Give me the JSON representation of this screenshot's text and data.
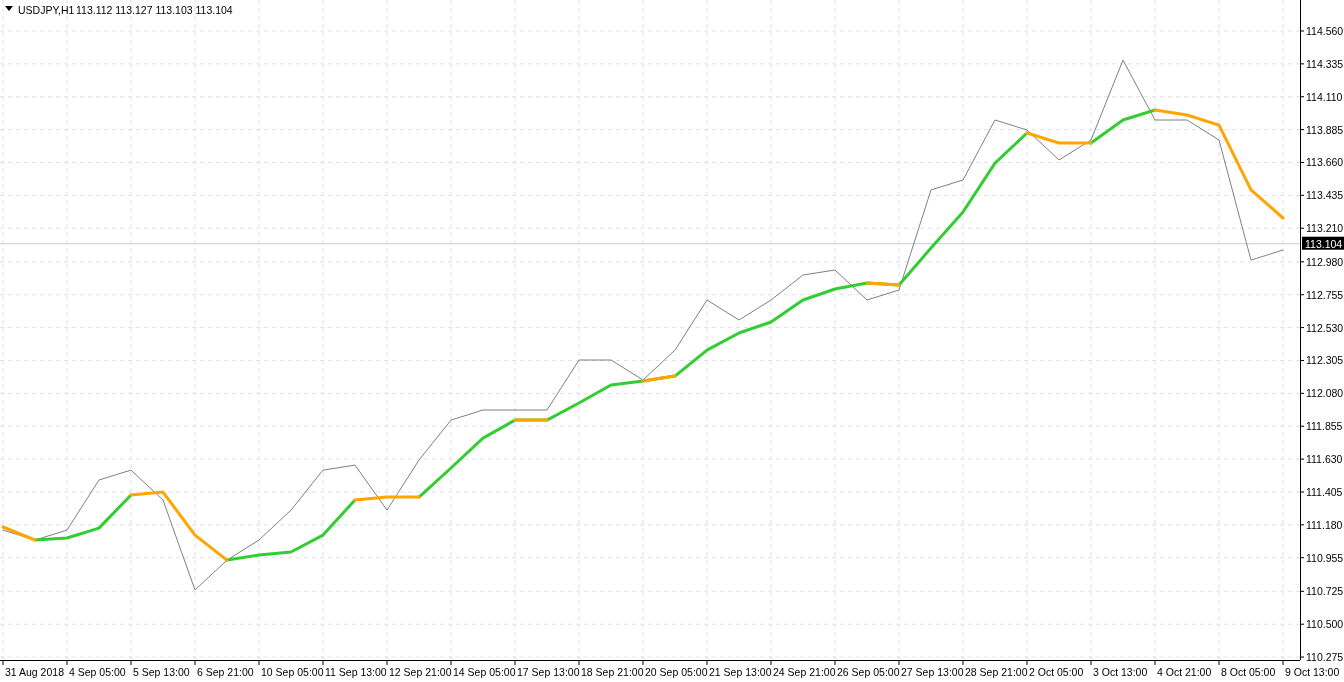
{
  "header": {
    "symbol": "USDJPY,H1",
    "quote": "113.112 113.127 113.103 113.104"
  },
  "chart_data": {
    "type": "line",
    "grid": true,
    "categories": [
      null,
      "31 Aug 2018",
      null,
      "4 Sep 05:00",
      null,
      "5 Sep 13:00",
      null,
      "6 Sep 21:00",
      null,
      "10 Sep 05:00",
      null,
      "11 Sep 13:00",
      null,
      "12 Sep 21:00",
      null,
      "14 Sep 05:00",
      null,
      "17 Sep 13:00",
      null,
      "18 Sep 21:00",
      null,
      "20 Sep 05:00",
      null,
      "21 Sep 13:00",
      null,
      "24 Sep 21:00",
      null,
      "26 Sep 05:00",
      null,
      "27 Sep 13:00",
      null,
      "28 Sep 21:00",
      null,
      "2 Oct 05:00",
      null,
      "3 Oct 13:00",
      null,
      "4 Oct 21:00",
      null,
      "8 Oct 05:00",
      null,
      "9 Oct 13:00"
    ],
    "series": [
      {
        "color": "#808080",
        "values": [
          111.144,
          111.076,
          111.144,
          111.487,
          111.555,
          111.35,
          110.734,
          110.939,
          111.076,
          111.281,
          111.555,
          111.589,
          111.281,
          111.623,
          111.897,
          111.966,
          111.966,
          111.966,
          112.308,
          112.308,
          112.171,
          112.376,
          112.719,
          112.582,
          112.719,
          112.89,
          112.924,
          112.719,
          112.787,
          113.472,
          113.54,
          113.951,
          113.882,
          113.677,
          113.814,
          114.361,
          113.951,
          113.951,
          113.814,
          112.992,
          113.061,
          null
        ]
      },
      {
        "color": "#32cd32",
        "values": [
          null,
          111.076,
          111.09,
          111.158,
          111.384,
          null,
          null,
          110.939,
          110.973,
          110.994,
          111.11,
          111.35,
          null,
          111.37,
          111.569,
          111.774,
          111.897,
          111.897,
          112.014,
          112.137,
          112.164,
          112.198,
          112.376,
          112.493,
          112.568,
          112.719,
          112.794,
          112.835,
          112.821,
          113.075,
          113.321,
          113.656,
          113.862,
          null,
          113.793,
          113.951,
          114.019,
          null,
          null,
          null,
          null,
          null
        ]
      },
      {
        "color": "#ffa500",
        "values": [
          111.165,
          111.076,
          null,
          null,
          111.384,
          111.404,
          111.11,
          110.939,
          null,
          null,
          null,
          111.35,
          111.37,
          111.37,
          null,
          null,
          111.897,
          111.897,
          null,
          null,
          112.164,
          112.198,
          null,
          null,
          null,
          null,
          null,
          112.835,
          112.821,
          null,
          null,
          null,
          113.862,
          113.793,
          113.793,
          null,
          114.019,
          113.985,
          113.916,
          113.472,
          113.28,
          null
        ]
      }
    ],
    "ylim": [
      110.255,
      114.772
    ],
    "yticks": [
      {
        "value": 110.275,
        "label": "110.275"
      },
      {
        "value": 110.5,
        "label": "110.500"
      },
      {
        "value": 110.725,
        "label": "110.725"
      },
      {
        "value": 110.955,
        "label": "110.955"
      },
      {
        "value": 111.18,
        "label": "111.180"
      },
      {
        "value": 111.405,
        "label": "111.405"
      },
      {
        "value": 111.63,
        "label": "111.630"
      },
      {
        "value": 111.855,
        "label": "111.855"
      },
      {
        "value": 112.08,
        "label": "112.080"
      },
      {
        "value": 112.305,
        "label": "112.305"
      },
      {
        "value": 112.53,
        "label": "112.530"
      },
      {
        "value": 112.755,
        "label": "112.755"
      },
      {
        "value": 112.98,
        "label": "112.980"
      },
      {
        "value": 113.21,
        "label": "113.210"
      },
      {
        "value": 113.435,
        "label": "113.435"
      },
      {
        "value": 113.66,
        "label": "113.660"
      },
      {
        "value": 113.885,
        "label": "113.885"
      },
      {
        "value": 114.11,
        "label": "114.110"
      },
      {
        "value": 114.335,
        "label": "114.335"
      },
      {
        "value": 114.56,
        "label": "114.560"
      }
    ],
    "ref_lines": [
      {
        "axis": "y",
        "value": 113.104,
        "label": "113.104"
      }
    ]
  }
}
